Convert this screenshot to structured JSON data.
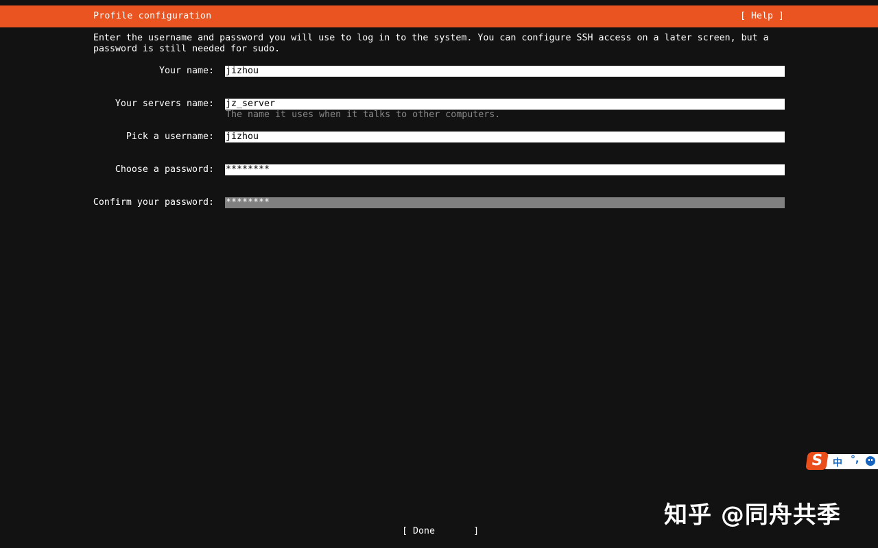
{
  "header": {
    "title": "Profile configuration",
    "help_label": "[ Help ]"
  },
  "intro": "Enter the username and password you will use to log in to the system. You can configure SSH access on a later screen, but a\npassword is still needed for sudo.",
  "form": {
    "your_name": {
      "label": "Your name:",
      "value": "jizhou"
    },
    "server_name": {
      "label": "Your servers name:",
      "value": "jz_server",
      "hint": "The name it uses when it talks to other computers."
    },
    "username": {
      "label": "Pick a username:",
      "value": "jizhou"
    },
    "password": {
      "label": "Choose a password:",
      "value": "********"
    },
    "confirm_password": {
      "label": "Confirm your password:",
      "value": "********"
    }
  },
  "footer": {
    "done_label": "[ Done       ]"
  },
  "ime": {
    "logo": "S",
    "mode": "中",
    "punct": "°,",
    "icon": "emoji-icon"
  },
  "watermark": "知乎 @同舟共季",
  "colors": {
    "accent": "#e95420",
    "background": "#121212",
    "active_field": "#808080",
    "hint": "#8a8a8a"
  }
}
